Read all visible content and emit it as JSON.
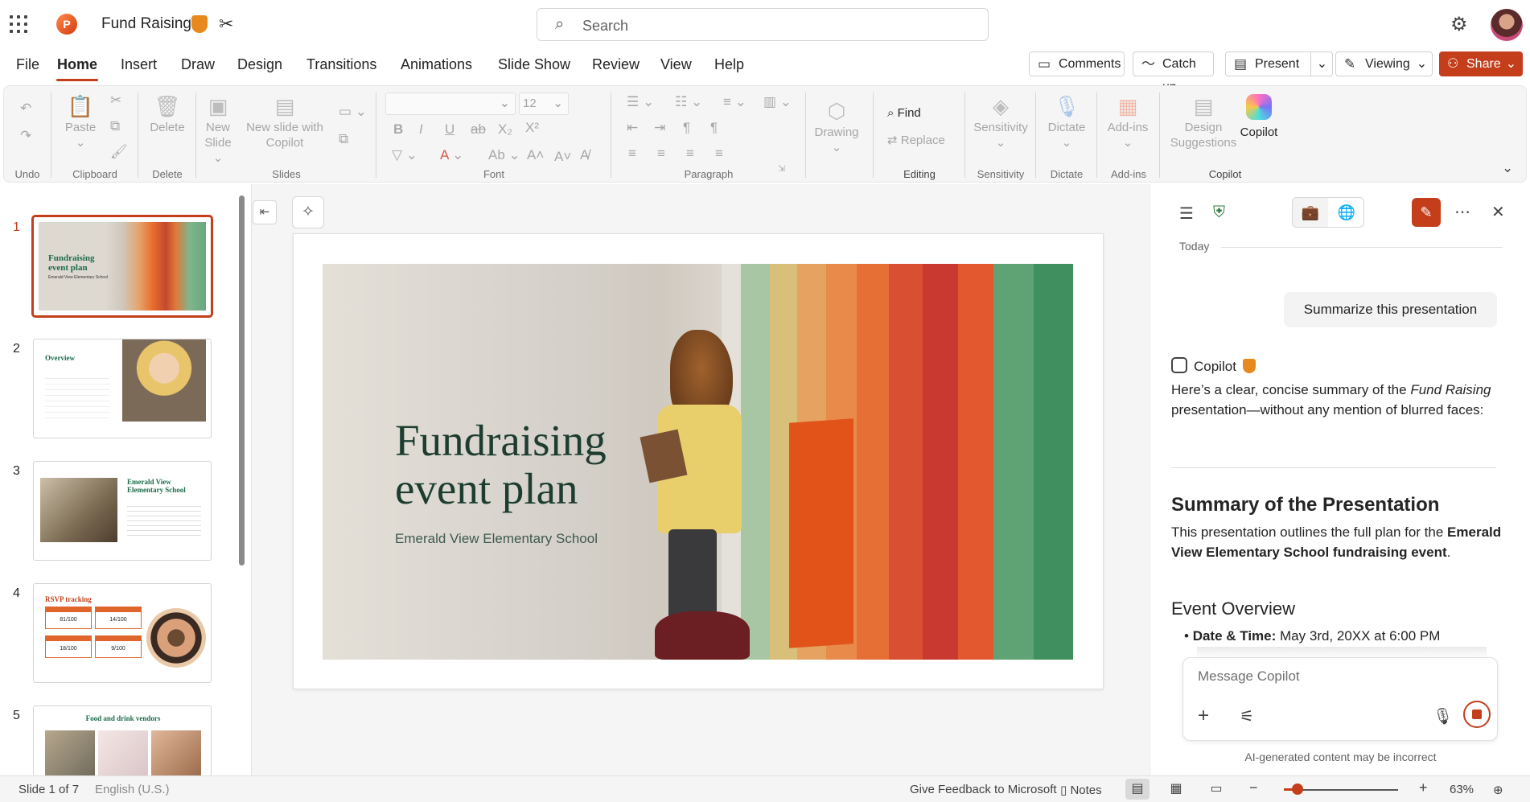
{
  "app": {
    "title": "Fund Raising",
    "search_placeholder": "Search"
  },
  "menu": {
    "items": [
      "File",
      "Home",
      "Insert",
      "Draw",
      "Design",
      "Transitions",
      "Animations",
      "Slide Show",
      "Review",
      "View",
      "Help"
    ],
    "active": "Home",
    "comments": "Comments",
    "catch_up": "Catch up",
    "present": "Present",
    "viewing": "Viewing",
    "share": "Share"
  },
  "ribbon": {
    "undo_label": "Undo",
    "paste_label": "Paste",
    "clipboard_label": "Clipboard",
    "delete_button": "Delete",
    "delete_label": "Delete",
    "new_slide_line1": "New",
    "new_slide_line2": "Slide",
    "new_slide_copilot_line1": "New slide with",
    "new_slide_copilot_line2": "Copilot",
    "slides_label": "Slides",
    "font_size": "12",
    "font_label": "Font",
    "paragraph_label": "Paragraph",
    "drawing": "Drawing",
    "find": "Find",
    "replace": "Replace",
    "editing_label": "Editing",
    "sensitivity_button": "Sensitivity",
    "sensitivity_label": "Sensitivity",
    "dictate_button": "Dictate",
    "dictate_label": "Dictate",
    "addins_button": "Add-ins",
    "addins_label": "Add-ins",
    "design_line1": "Design",
    "design_line2": "Suggestions",
    "copilot_button": "Copilot",
    "copilot_label": "Copilot"
  },
  "thumbnails": [
    {
      "num": "1",
      "title": "Fundraising event plan",
      "subtitle": "Emerald View Elementary School"
    },
    {
      "num": "2",
      "title": "Overview"
    },
    {
      "num": "3",
      "title": "Emerald View Elementary School"
    },
    {
      "num": "4",
      "title": "RSVP tracking",
      "cells": [
        "81/100",
        "14/100",
        "18/100",
        "9/100"
      ]
    },
    {
      "num": "5",
      "title": "Food and drink vendors"
    }
  ],
  "slide": {
    "title_line1": "Fundraising",
    "title_line2": "event plan",
    "subtitle": "Emerald View Elementary School"
  },
  "copilot": {
    "today": "Today",
    "user_message": "Summarize this presentation",
    "name": "Copilot",
    "intro_pre": "Here’s a clear, concise summary of the ",
    "intro_em": "Fund Raising",
    "intro_post": " presentation—without any mention of blurred faces:",
    "summary_heading": "Summary of the Presentation",
    "summary_pre": "This presentation outlines the full plan for the ",
    "summary_bold": "Emerald View Elementary School fundraising event",
    "summary_post": ".",
    "overview_heading": "Event Overview",
    "bullet_label": "Date & Time:",
    "bullet_value": " May 3rd, 20XX at 6:00 PM",
    "input_placeholder": "Message Copilot",
    "disclaimer": "AI-generated content may be incorrect"
  },
  "status": {
    "slide_count": "Slide 1 of 7",
    "language": "English (U.S.)",
    "feedback": "Give Feedback to Microsoft",
    "notes": "Notes",
    "zoom": "63%",
    "zoom_level_fraction": 0.1
  },
  "colors": {
    "accent": "#c43e1c",
    "slide_title": "#1c3d2f"
  }
}
